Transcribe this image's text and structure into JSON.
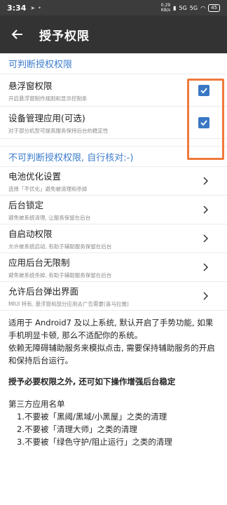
{
  "status_bar": {
    "time": "3:34",
    "net_speed_value": "0.29",
    "net_speed_unit": "KB/s",
    "battery": "45",
    "signal_1": "5G",
    "signal_2": "5G"
  },
  "app_bar": {
    "title": "授予权限"
  },
  "section_checkable": {
    "title": "可判断授权权限",
    "items": [
      {
        "title": "悬浮窗权限",
        "subtitle": "开启悬浮窗制作规则和显示控制条",
        "checked": true
      },
      {
        "title": "设备管理应用(可选)",
        "subtitle": "对于部分机型可提高服务保持后台的稳定性",
        "checked": true
      }
    ]
  },
  "section_manual": {
    "title": "不可判断授权权限, 自行核对:-)",
    "items": [
      {
        "title": "电池优化设置",
        "subtitle": "选择「不优化」避免被清理和杀掉"
      },
      {
        "title": "后台锁定",
        "subtitle": "避免被系统清理, 让服务保留在后台"
      },
      {
        "title": "自启动权限",
        "subtitle": "允许被系统启动, 有助于辅助服务保留在后台"
      },
      {
        "title": "应用后台无限制",
        "subtitle": "避免被系统杀掉, 有助于辅助服务保留在后台"
      },
      {
        "title": "允许后台弹出界面",
        "subtitle": "MIUI 特有, 悬浮窗和部分应用去广告需要(喜马拉雅)"
      }
    ]
  },
  "info": {
    "para1": "适用于 Android7 及以上系统, 默认开启了手势功能, 如果手机明显卡顿, 那么不适配你的系统。",
    "para2": "依赖无障碍辅助服务来模拟点击, 需要保持辅助服务的开启和保持后台运行。",
    "bold_line": "授予必要权限之外, 还可如下操作增强后台稳定",
    "subhead": "第三方应用名单",
    "list": [
      "1.不要被「黑阈/黑域/小黑屋」之类的清理",
      "2.不要被「清理大师」之类的清理",
      "3.不要被「绿色守护/阻止运行」之类的清理"
    ]
  },
  "colors": {
    "accent": "#3d7dcc",
    "checkbox": "#3a78c4",
    "highlight": "#f07a3c",
    "app_bar": "#333333"
  }
}
